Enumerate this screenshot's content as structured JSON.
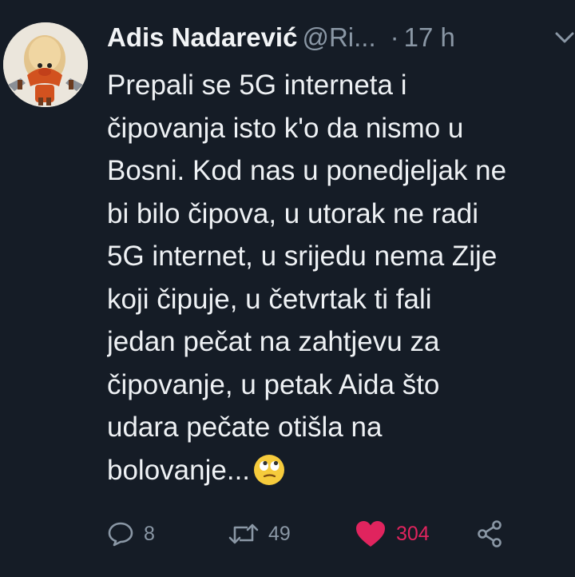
{
  "tweet": {
    "author_name": "Adis Nadarević",
    "handle": "@Ri...",
    "separator": "·",
    "time": "17 h",
    "lines": [
      "Prepali se 5G interneta i",
      "čipovanja isto k'o da nismo u",
      "Bosni. Kod nas u ponedjeljak ne",
      "bi bilo čipova, u utorak ne radi",
      "5G internet, u srijedu nema Zije",
      "koji čipuje, u četvrtak ti fali",
      "jedan pečat na zahtjevu za",
      "čipovanje, u petak Aida što",
      "udara pečate otišla na",
      "bolovanje..."
    ],
    "emoji": "face-with-rolling-eyes-icon"
  },
  "actions": {
    "reply_count": "8",
    "retweet_count": "49",
    "like_count": "304",
    "liked": true
  },
  "colors": {
    "background": "#151c26",
    "text": "#eef1f4",
    "muted": "#8a97a5",
    "like": "#e0245e"
  }
}
